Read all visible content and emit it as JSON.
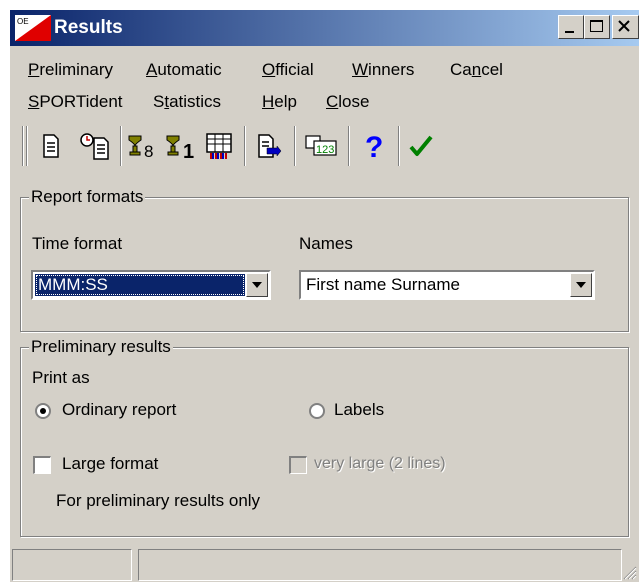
{
  "window": {
    "title": "Results",
    "minimize_glyph": "_",
    "maximize_glyph": "□",
    "close_glyph": "✕"
  },
  "menu": {
    "row1": [
      {
        "pre": "",
        "key": "P",
        "post": "reliminary"
      },
      {
        "pre": "",
        "key": "A",
        "post": "utomatic"
      },
      {
        "pre": "",
        "key": "O",
        "post": "fficial"
      },
      {
        "pre": "",
        "key": "W",
        "post": "inners"
      },
      {
        "pre": "Ca",
        "key": "n",
        "post": "cel"
      }
    ],
    "row2": [
      {
        "pre": "",
        "key": "S",
        "post": "PORTident"
      },
      {
        "pre": "S",
        "key": "t",
        "post": "atistics"
      },
      {
        "pre": "",
        "key": "H",
        "post": "elp"
      },
      {
        "pre": "",
        "key": "C",
        "post": "lose"
      }
    ]
  },
  "toolbar": {
    "buttons": [
      "document-icon",
      "timed-document-icon",
      "trophy-8-icon",
      "trophy-1-icon",
      "results-table-icon",
      "export-document-icon",
      "numbered-table-icon",
      "help-icon",
      "ok-check-icon"
    ],
    "colors": {
      "help": "#0000ff",
      "ok": "#008000"
    }
  },
  "report_formats": {
    "legend": "Report formats",
    "time_format_label": "Time format",
    "time_format_value": "MMM:SS",
    "names_label": "Names",
    "names_value": "First name Surname"
  },
  "preliminary": {
    "legend": "Preliminary results",
    "print_as_label": "Print as",
    "ordinary_report_label": "Ordinary report",
    "ordinary_report_checked": true,
    "labels_label": "Labels",
    "labels_checked": false,
    "large_format_label": "Large format",
    "large_format_checked": false,
    "very_large_label": "very large (2 lines)",
    "very_large_enabled": false,
    "note": "For preliminary results only"
  }
}
